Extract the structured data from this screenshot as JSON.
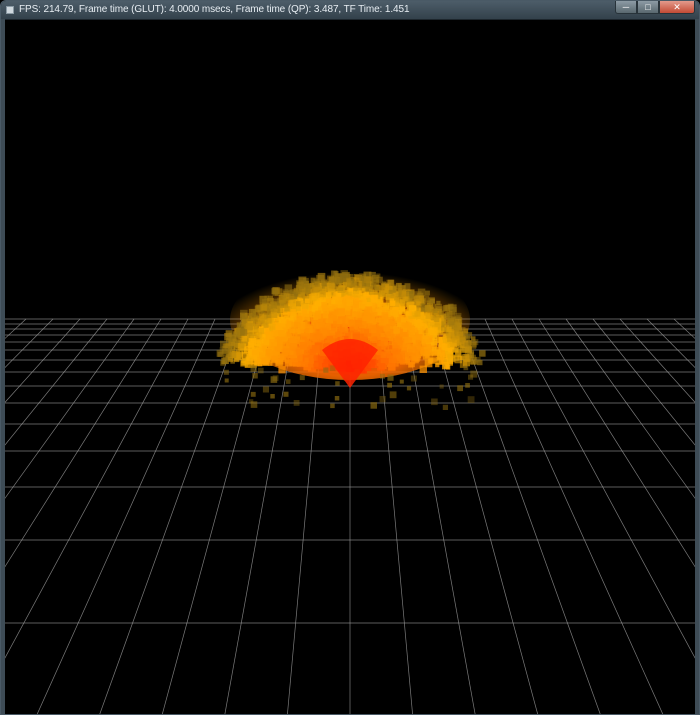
{
  "window": {
    "title": "FPS: 214.79, Frame time (GLUT): 4.0000 msecs, Frame time (QP): 3.487, TF Time: 1.451",
    "minimize_icon": "minimize-icon",
    "maximize_icon": "maximize-icon",
    "close_icon": "close-icon"
  },
  "scene": {
    "background": "#000000",
    "grid_color": "#9a9a9a",
    "particle_colors": {
      "core": "#ff2200",
      "mid": "#ff7a00",
      "outer": "#ffb000",
      "faint": "#8a6a10"
    }
  }
}
